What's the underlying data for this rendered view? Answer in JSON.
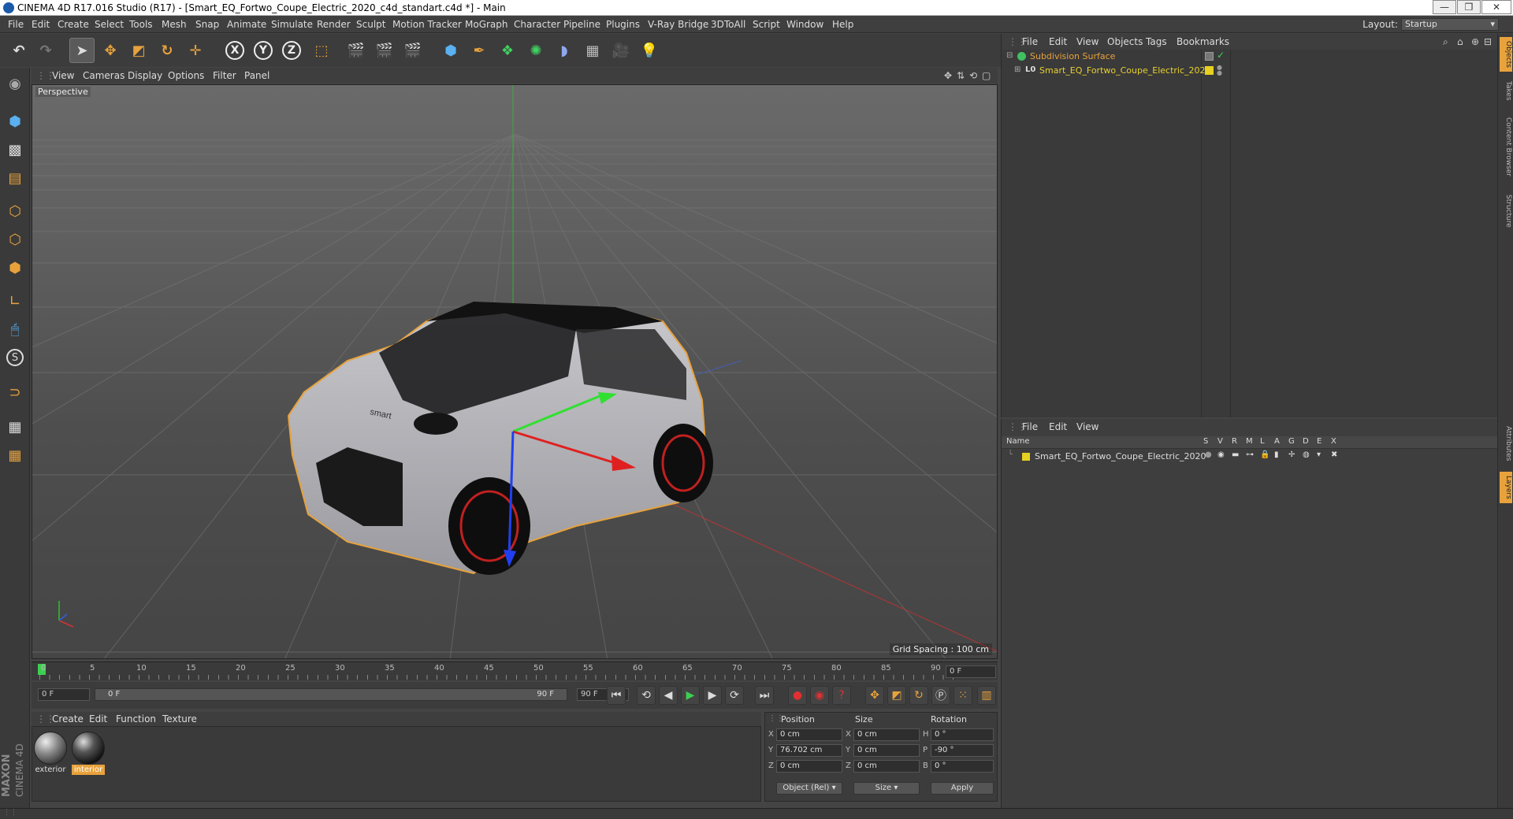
{
  "window": {
    "title": "CINEMA 4D R17.016 Studio (R17) - [Smart_EQ_Fortwo_Coupe_Electric_2020_c4d_standart.c4d *] - Main",
    "controls": [
      "—",
      "❒",
      "✕"
    ]
  },
  "menubar": {
    "items": [
      "File",
      "Edit",
      "Create",
      "Select",
      "Tools",
      "Mesh",
      "Snap",
      "Animate",
      "Simulate",
      "Render",
      "Sculpt",
      "Motion Tracker",
      "MoGraph",
      "Character",
      "Pipeline",
      "Plugins",
      "V-Ray Bridge",
      "3DToAll",
      "Script",
      "Window",
      "Help"
    ],
    "layout_label": "Layout:",
    "layout_value": "Startup"
  },
  "toolbar": {
    "axis_x": "X",
    "axis_y": "Y",
    "axis_z": "Z"
  },
  "viewport": {
    "menu": [
      "View",
      "Cameras",
      "Display",
      "Options",
      "Filter",
      "Panel"
    ],
    "label": "Perspective",
    "grid_spacing": "Grid Spacing : 100 cm",
    "car_brand": "smart"
  },
  "timeline": {
    "ticks": [
      "0",
      "5",
      "10",
      "15",
      "20",
      "25",
      "30",
      "35",
      "40",
      "45",
      "50",
      "55",
      "60",
      "65",
      "70",
      "75",
      "80",
      "85",
      "90"
    ],
    "current_frame": "0 F",
    "start_frame": "0 F",
    "range_start": "0 F",
    "range_end": "90 F",
    "end_frame": "90 F"
  },
  "materials": {
    "menu": [
      "Create",
      "Edit",
      "Function",
      "Texture"
    ],
    "items": [
      {
        "name": "exterior"
      },
      {
        "name": "interior"
      }
    ]
  },
  "coordinates": {
    "headers": {
      "position": "Position",
      "size": "Size",
      "rotation": "Rotation"
    },
    "rows": [
      {
        "pos_label": "X",
        "pos": "0 cm",
        "size_label": "X",
        "size": "0 cm",
        "rot_label": "H",
        "rot": "0 °"
      },
      {
        "pos_label": "Y",
        "pos": "76.702 cm",
        "size_label": "Y",
        "size": "0 cm",
        "rot_label": "P",
        "rot": "-90 °"
      },
      {
        "pos_label": "Z",
        "pos": "0 cm",
        "size_label": "Z",
        "size": "0 cm",
        "rot_label": "B",
        "rot": "0 °"
      }
    ],
    "mode": "Object (Rel)",
    "size_mode": "Size",
    "apply": "Apply"
  },
  "object_manager": {
    "menu": [
      "File",
      "Edit",
      "View",
      "Objects",
      "Tags",
      "Bookmarks"
    ],
    "objects": [
      {
        "name": "Subdivision Surface"
      },
      {
        "name": "Smart_EQ_Fortwo_Coupe_Electric_2020"
      }
    ]
  },
  "layer_manager": {
    "menu": [
      "File",
      "Edit",
      "View"
    ],
    "columns": [
      "Name",
      "S",
      "V",
      "R",
      "M",
      "L",
      "A",
      "G",
      "D",
      "E",
      "X"
    ],
    "layers": [
      {
        "name": "Smart_EQ_Fortwo_Coupe_Electric_2020"
      }
    ]
  },
  "right_tabs": [
    "Objects",
    "Takes",
    "Content Browser",
    "Structure",
    "Attributes",
    "Layers"
  ],
  "branding": {
    "maxon": "MAXON",
    "cinema": "CINEMA 4D"
  },
  "colors": {
    "accent_orange": "#e8a23c",
    "layer_yellow": "#e6d020",
    "axis_x": "#e03030",
    "axis_y": "#30c030",
    "axis_z": "#3060e0"
  }
}
